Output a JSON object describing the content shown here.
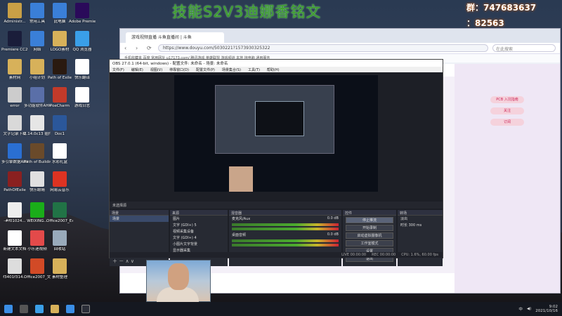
{
  "overlay_title": "技能S2V3迪娜香铭文",
  "qq": {
    "line1": "群：747683637",
    "line2": "：82563"
  },
  "desktop_icons": [
    {
      "label": "Administr...",
      "color": "#c9a046"
    },
    {
      "label": "Premiere CC2019",
      "color": "#1a1d3a"
    },
    {
      "label": "素材网",
      "color": "#d7b15a"
    },
    {
      "label": "error",
      "color": "#ccc"
    },
    {
      "label": "文字记录下载",
      "color": "#d9d9d9"
    },
    {
      "label": "多引擎数据AHK2019",
      "color": "#2a6fd2"
    },
    {
      "label": "PathOfExile",
      "color": "#8a2020"
    },
    {
      "label": "-#f01024...",
      "color": "#eee"
    },
    {
      "label": "新建文本文档",
      "color": "#fff"
    },
    {
      "label": "f3401f314...",
      "color": "#ddd"
    },
    {
      "label": "常用工具",
      "color": "#3a7fd8"
    },
    {
      "label": "网络",
      "color": "#3a7fd8"
    },
    {
      "label": "小组计划",
      "color": "#d7b15a"
    },
    {
      "label": "多功能软件AHK",
      "color": "#5a6fa8"
    },
    {
      "label": "2.14.0c13 插件",
      "color": "#e6e6e6"
    },
    {
      "label": "Path of Building",
      "color": "#6a4a2a"
    },
    {
      "label": "快乐眼睛",
      "color": "#e0e0e0"
    },
    {
      "label": "WEIXING...",
      "color": "#1aad19"
    },
    {
      "label": "小乐迷视频",
      "color": "#e34a4a"
    },
    {
      "label": "Office2007_文档",
      "color": "#d24a26"
    },
    {
      "label": "此电脑",
      "color": "#3a7fd8"
    },
    {
      "label": "LOGO素材",
      "color": "#d7b15a"
    },
    {
      "label": "Path of Exile",
      "color": "#2a1a10"
    },
    {
      "label": "PoeCharm",
      "color": "#c23a2a"
    },
    {
      "label": "Doc1",
      "color": "#2b579a"
    },
    {
      "label": "水彩礼盒",
      "color": "#fff"
    },
    {
      "label": "网易云音乐",
      "color": "#d32"
    },
    {
      "label": "Office2007_Excel",
      "color": "#217346"
    },
    {
      "label": "回收站",
      "color": "#9ab"
    },
    {
      "label": "素材整理",
      "color": "#d7b15a"
    },
    {
      "label": "Adobe Premie...",
      "color": "#2a0a5a"
    },
    {
      "label": "QQ 浏览器",
      "color": "#3a9fe8"
    },
    {
      "label": "快乐翻译",
      "color": "#fff"
    },
    {
      "label": "游戏日志",
      "color": "#fff"
    }
  ],
  "browser": {
    "tab": "游戏视频直播 斗鱼直播间 | 斗鱼",
    "url": "https://www.douyu.com/5030221?1573930325322",
    "search": "在此搜索",
    "favorites": "手机收藏夹  百度   常用网址  u17173.com/   腾讯游戏  英雄联盟  游戏频道  本地   拖电脑  通用服务"
  },
  "page_buttons": [
    "PCB 入坑指南",
    "关注",
    "订阅"
  ],
  "obs": {
    "title": "OBS 27.0.1 (64-bit, windows) - 配置文件: 未命名 - 场景: 未命名",
    "menu": [
      "文件(F)",
      "编辑(E)",
      "视图(V)",
      "停靠窗口(D)",
      "配置文件(P)",
      "场景集合(S)",
      "工具(T)",
      "帮助(H)"
    ],
    "no_source": "未选择源",
    "docks": {
      "scenes": "场景",
      "sources": "来源",
      "mixer": "混音器",
      "transitions": "转场",
      "controls": "控件"
    },
    "scenes": [
      "场景"
    ],
    "sources": [
      "图片",
      "文字 (GDI+) 5",
      "视频采集设备",
      "文字 (GDI+) 4",
      "小图片文字背景",
      "显示器采集"
    ],
    "mixer": [
      {
        "name": "麦克风/Aux",
        "db": "0.0 dB"
      },
      {
        "name": "桌面音频",
        "db": "0.0 dB"
      }
    ],
    "transition": {
      "type": "淡出",
      "duration_label": "时长",
      "duration": "300 ms"
    },
    "controls": [
      "停止推流",
      "开始录制",
      "启动虚拟摄像机",
      "工作室模式",
      "设置",
      "退出"
    ],
    "status": [
      "LIVE 00:00:00",
      "REC 00:00:00",
      "CPU: 1.6%, 60.00 fps"
    ]
  },
  "taskbar": {
    "time": "9:02",
    "date": "2021/10/16",
    "lang": "中"
  }
}
